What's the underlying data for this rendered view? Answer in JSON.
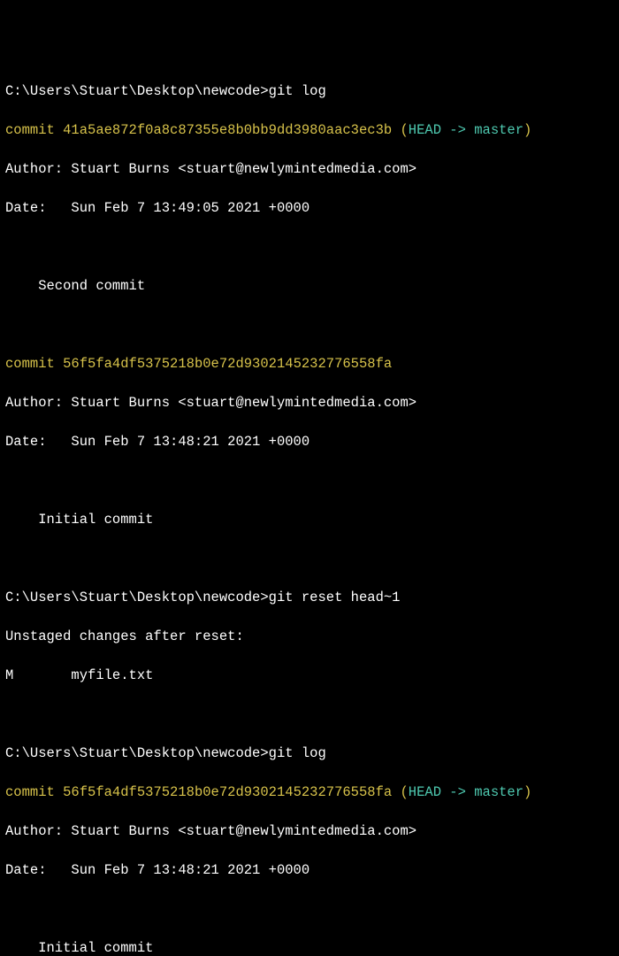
{
  "prompt_path": "C:\\Users\\Stuart\\Desktop\\newcode>",
  "cmd_gitlog": "git log",
  "cmd_reset": "git reset head~1",
  "refs": {
    "head": "HEAD -> ",
    "branch": "master"
  },
  "commits": {
    "second": {
      "hash": "41a5ae872f0a8c87355e8b0bb9dd3980aac3ec3b",
      "author": "Author: Stuart Burns <stuart@newlymintedmedia.com>",
      "date": "Date:   Sun Feb 7 13:49:05 2021 +0000",
      "msg": "    Second commit"
    },
    "initial": {
      "hash": "56f5fa4df5375218b0e72d9302145232776558fa",
      "author": "Author: Stuart Burns <stuart@newlymintedmedia.com>",
      "date": "Date:   Sun Feb 7 13:48:21 2021 +0000",
      "msg": "    Initial commit"
    }
  },
  "reset_output": {
    "line1": "Unstaged changes after reset:",
    "line2": "M       myfile.txt"
  },
  "commit_word": "commit ",
  "paren_open": " (",
  "paren_close": ")"
}
